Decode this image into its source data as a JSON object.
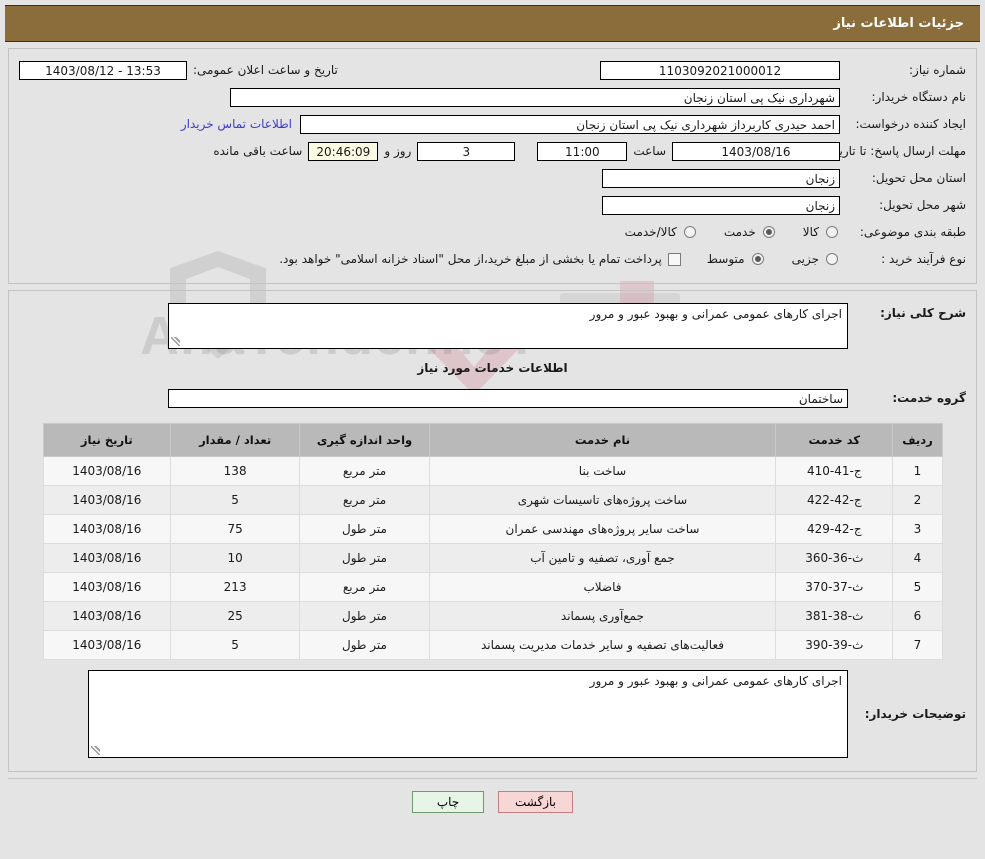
{
  "header": {
    "title": "جزئیات اطلاعات نیاز",
    "bar_color": "#8a6d3b"
  },
  "watermark": {
    "text": "AnaTender.neT"
  },
  "form": {
    "need_number_label": "شماره نیاز:",
    "need_number_value": "1103092021000012",
    "public_announce_label": "تاریخ و ساعت اعلان عمومی:",
    "public_announce_value": "1403/08/12 - 13:53",
    "buyer_org_label": "نام دستگاه خریدار:",
    "buyer_org_value": "شهرداری نیک پی استان زنجان",
    "creator_label": "ایجاد کننده درخواست:",
    "creator_value": "احمد حیدری کاربرداز شهرداری نیک پی استان زنجان",
    "contact_link": "اطلاعات تماس خریدار",
    "deadline_label": "مهلت ارسال پاسخ: تا تاریخ:",
    "deadline_date": "1403/08/16",
    "hour_label": "ساعت",
    "deadline_time": "11:00",
    "days_value": "3",
    "days_label": "روز و",
    "remaining_value": "20:46:09",
    "remaining_label": "ساعت باقی مانده",
    "province_label": "استان محل تحویل:",
    "province_value": "زنجان",
    "city_label": "شهر محل تحویل:",
    "city_value": "زنجان",
    "category_label": "طبقه بندی موضوعی:",
    "category_options": [
      {
        "label": "کالا",
        "selected": false
      },
      {
        "label": "خدمت",
        "selected": true
      },
      {
        "label": "کالا/خدمت",
        "selected": false
      }
    ],
    "process_label": "نوع فرآیند خرید :",
    "process_options": [
      {
        "label": "جزیی",
        "selected": false
      },
      {
        "label": "متوسط",
        "selected": true
      }
    ],
    "treasury_checkbox_checked": false,
    "treasury_note": "پرداخت تمام یا بخشی از مبلغ خرید،از محل \"اسناد خزانه اسلامی\" خواهد بود."
  },
  "summary": {
    "label": "شرح کلی نیاز:",
    "value": "اجرای کارهای عمومی عمرانی و بهبود عبور و مرور"
  },
  "services": {
    "heading": "اطلاعات خدمات مورد نیاز",
    "group_label": "گروه خدمت:",
    "group_value": "ساختمان",
    "columns": [
      "ردیف",
      "کد خدمت",
      "نام خدمت",
      "واحد اندازه گیری",
      "تعداد / مقدار",
      "تاریخ نیاز"
    ],
    "rows": [
      {
        "radif": "1",
        "code": "ج-41-410",
        "name": "ساخت بنا",
        "unit": "متر مربع",
        "qty": "138",
        "date": "1403/08/16"
      },
      {
        "radif": "2",
        "code": "ج-42-422",
        "name": "ساخت پروژه‌های تاسیسات شهری",
        "unit": "متر مربع",
        "qty": "5",
        "date": "1403/08/16"
      },
      {
        "radif": "3",
        "code": "ج-42-429",
        "name": "ساخت سایر پروژه‌های مهندسی عمران",
        "unit": "متر طول",
        "qty": "75",
        "date": "1403/08/16"
      },
      {
        "radif": "4",
        "code": "ث-36-360",
        "name": "جمع آوری، تصفیه و تامین آب",
        "unit": "متر طول",
        "qty": "10",
        "date": "1403/08/16"
      },
      {
        "radif": "5",
        "code": "ث-37-370",
        "name": "فاضلاب",
        "unit": "متر مربع",
        "qty": "213",
        "date": "1403/08/16"
      },
      {
        "radif": "6",
        "code": "ث-38-381",
        "name": "جمع‌آوری پسماند",
        "unit": "متر طول",
        "qty": "25",
        "date": "1403/08/16"
      },
      {
        "radif": "7",
        "code": "ث-39-390",
        "name": "فعالیت‌های تصفیه و سایر خدمات مدیریت پسماند",
        "unit": "متر طول",
        "qty": "5",
        "date": "1403/08/16"
      }
    ]
  },
  "buyer_notes": {
    "label": "توضیحات خریدار:",
    "value": "اجرای کارهای عمومی عمرانی و بهبود عبور و مرور"
  },
  "footer": {
    "print_label": "چاپ",
    "back_label": "بازگشت"
  }
}
